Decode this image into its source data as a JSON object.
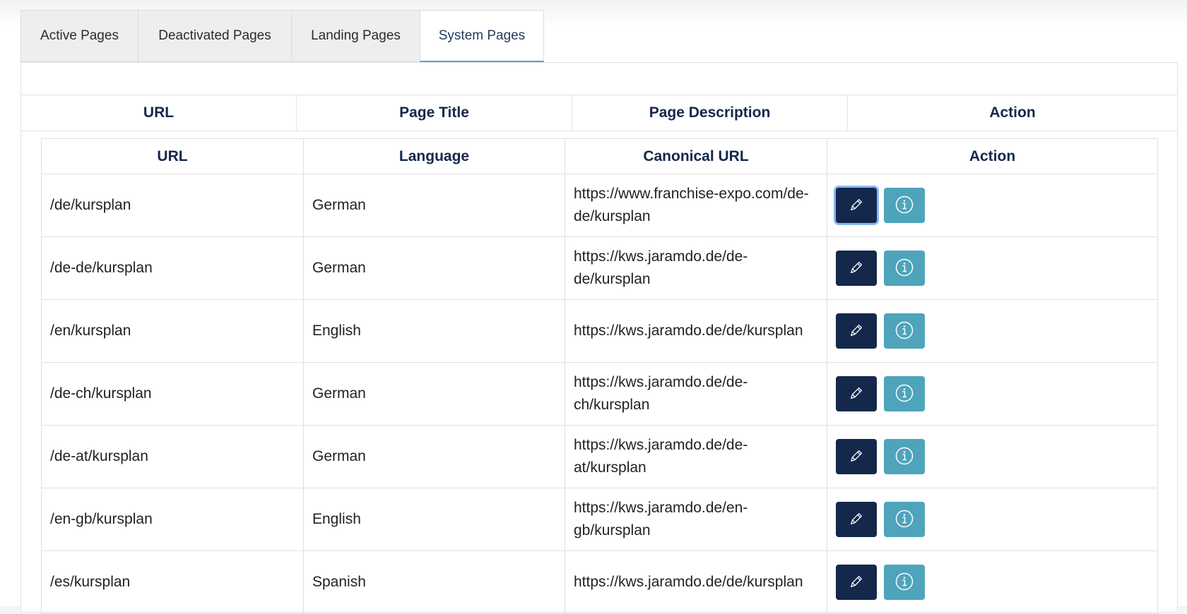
{
  "tabs": [
    {
      "label": "Active Pages"
    },
    {
      "label": "Deactivated Pages"
    },
    {
      "label": "Landing Pages"
    },
    {
      "label": "System Pages"
    }
  ],
  "active_tab": "System Pages",
  "outer_table": {
    "headers": [
      "URL",
      "Page Title",
      "Page Description",
      "Action"
    ]
  },
  "inner_table": {
    "headers": [
      "URL",
      "Language",
      "Canonical URL",
      "Action"
    ],
    "rows": [
      {
        "url": "/de/kursplan",
        "language": "German",
        "canonical": "https://www.franchise-expo.com/de-de/kursplan"
      },
      {
        "url": "/de-de/kursplan",
        "language": "German",
        "canonical": "https://kws.jaramdo.de/de-de/kursplan"
      },
      {
        "url": "/en/kursplan",
        "language": "English",
        "canonical": "https://kws.jaramdo.de/de/kursplan"
      },
      {
        "url": "/de-ch/kursplan",
        "language": "German",
        "canonical": "https://kws.jaramdo.de/de-ch/kursplan"
      },
      {
        "url": "/de-at/kursplan",
        "language": "German",
        "canonical": "https://kws.jaramdo.de/de-at/kursplan"
      },
      {
        "url": "/en-gb/kursplan",
        "language": "English",
        "canonical": "https://kws.jaramdo.de/en-gb/kursplan"
      },
      {
        "url": "/es/kursplan",
        "language": "Spanish",
        "canonical": "https://kws.jaramdo.de/de/kursplan"
      }
    ]
  },
  "icons": {
    "edit": "pencil-icon",
    "info": "info-circle-icon"
  },
  "colors": {
    "primary": "#14284b",
    "info": "#4ea4bb",
    "active_tab_accent": "#4fa6c9"
  }
}
